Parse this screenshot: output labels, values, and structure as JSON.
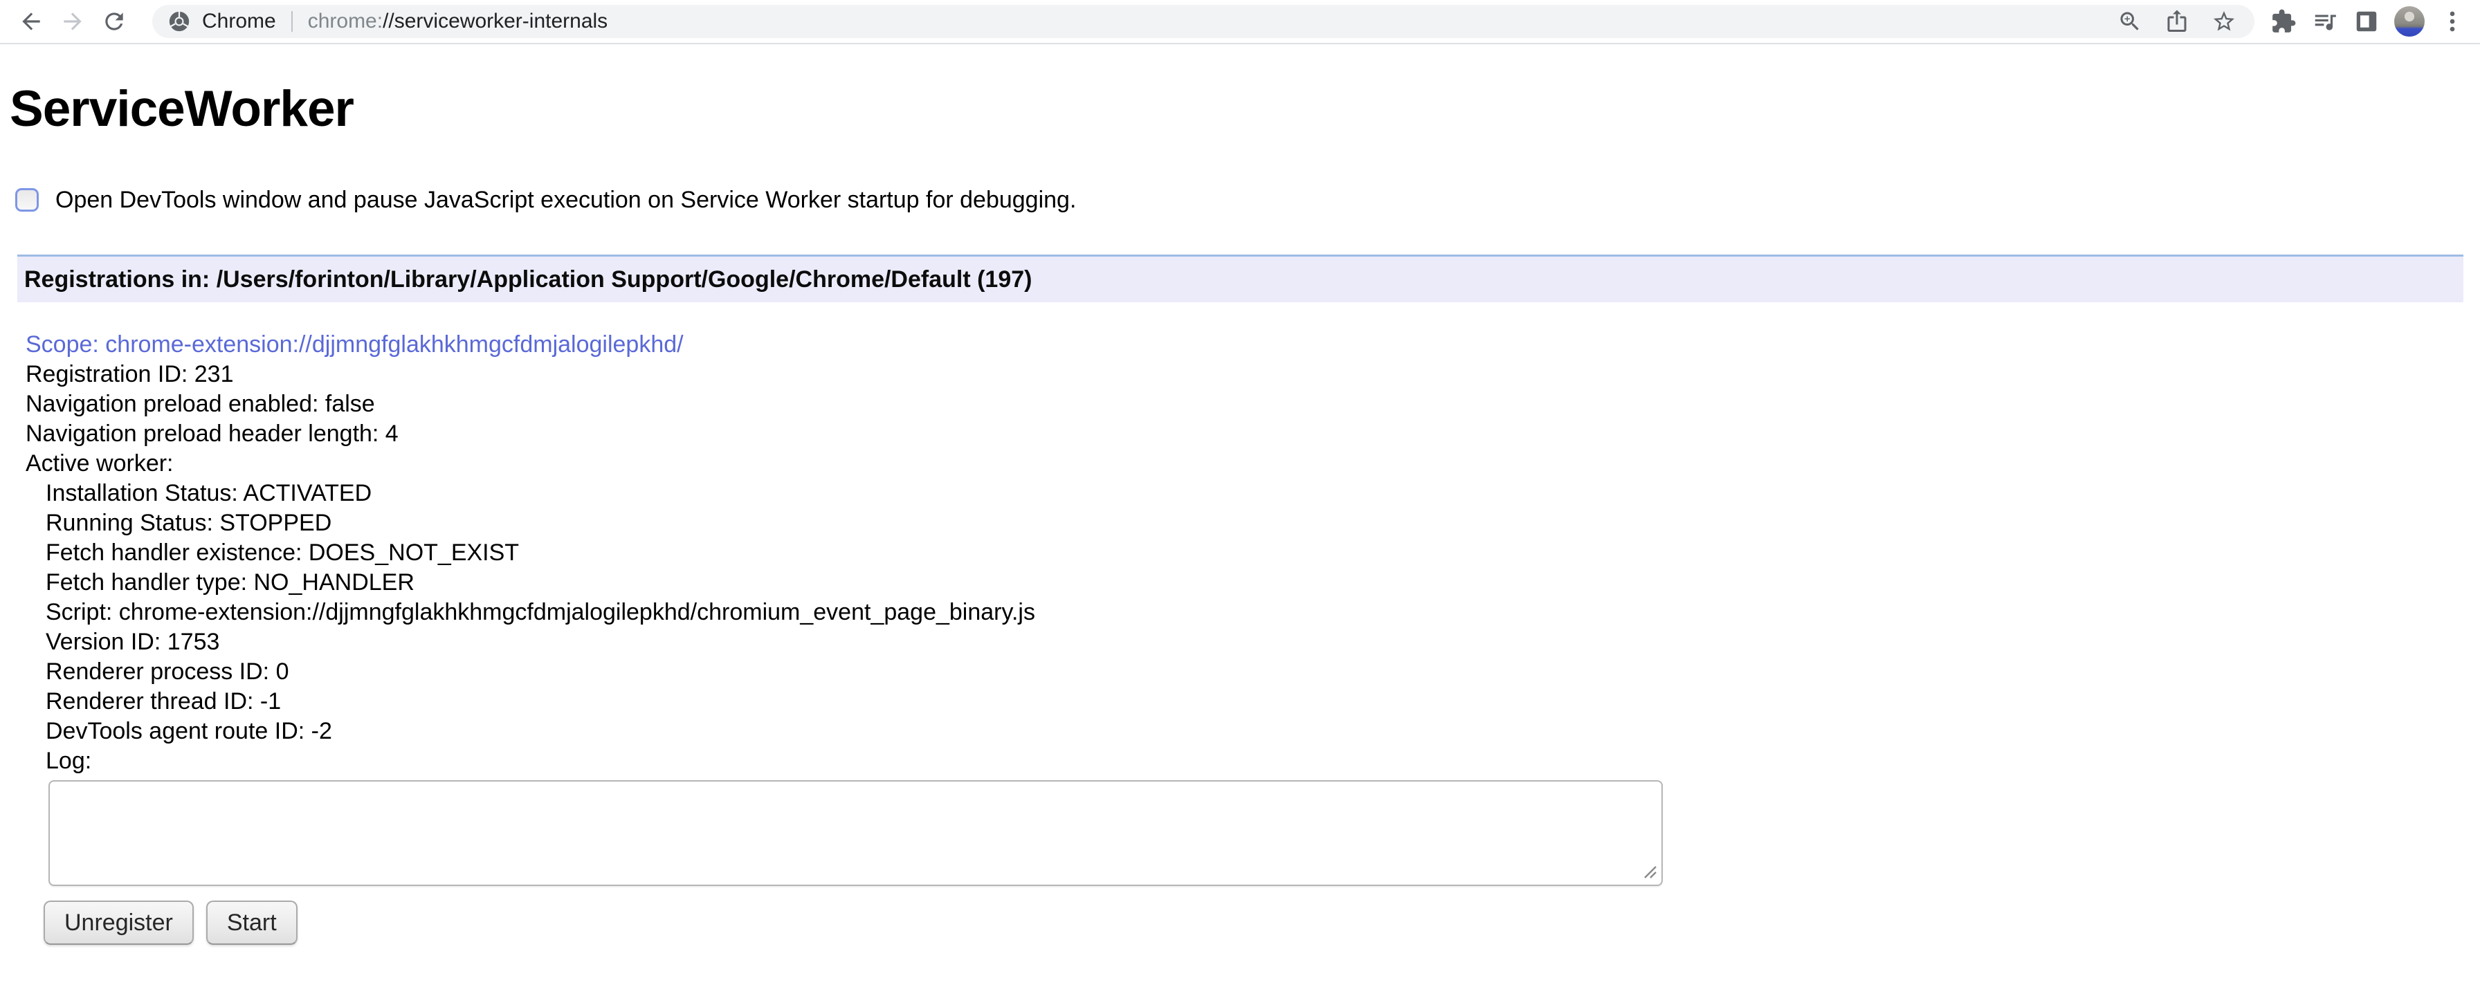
{
  "browser": {
    "site_label": "Chrome",
    "url_scheme": "chrome:",
    "url_host": "//serviceworker-internals",
    "icons": [
      "back-icon",
      "forward-icon",
      "reload-icon",
      "chrome-logo-icon",
      "zoom-in-icon",
      "share-icon",
      "bookmark-star-icon",
      "extensions-puzzle-icon",
      "media-controls-icon",
      "side-panel-icon",
      "avatar",
      "kebab-menu-icon"
    ]
  },
  "page": {
    "title": "ServiceWorker",
    "devtools_checkbox_label": "Open DevTools window and pause JavaScript execution on Service Worker startup for debugging.",
    "registrations_header": "Registrations in: /Users/forinton/Library/Application Support/Google/Chrome/Default (197)",
    "registration": {
      "scope": "Scope: chrome-extension://djjmngfglakhkhmgcfdmjalogilepkhd/",
      "fields": [
        "Registration ID: 231",
        "Navigation preload enabled: false",
        "Navigation preload header length: 4",
        "Active worker:"
      ],
      "worker_fields": [
        "Installation Status: ACTIVATED",
        "Running Status: STOPPED",
        "Fetch handler existence: DOES_NOT_EXIST",
        "Fetch handler type: NO_HANDLER",
        "Script: chrome-extension://djjmngfglakhkhmgcfdmjalogilepkhd/chromium_event_page_binary.js",
        "Version ID: 1753",
        "Renderer process ID: 0",
        "Renderer thread ID: -1",
        "DevTools agent route ID: -2",
        "Log:"
      ],
      "log_value": "",
      "unregister_label": "Unregister",
      "start_label": "Start"
    },
    "colors": {
      "link": "#5a69d7",
      "header_bg": "#ebebfa",
      "header_border": "#9ebce4",
      "checkbox_border": "#7e96e6",
      "toolbar_icon": "#5f6368",
      "omnibox_bg": "#f1f3f4",
      "url_scheme": "#80868b",
      "url_host": "#202124"
    }
  }
}
